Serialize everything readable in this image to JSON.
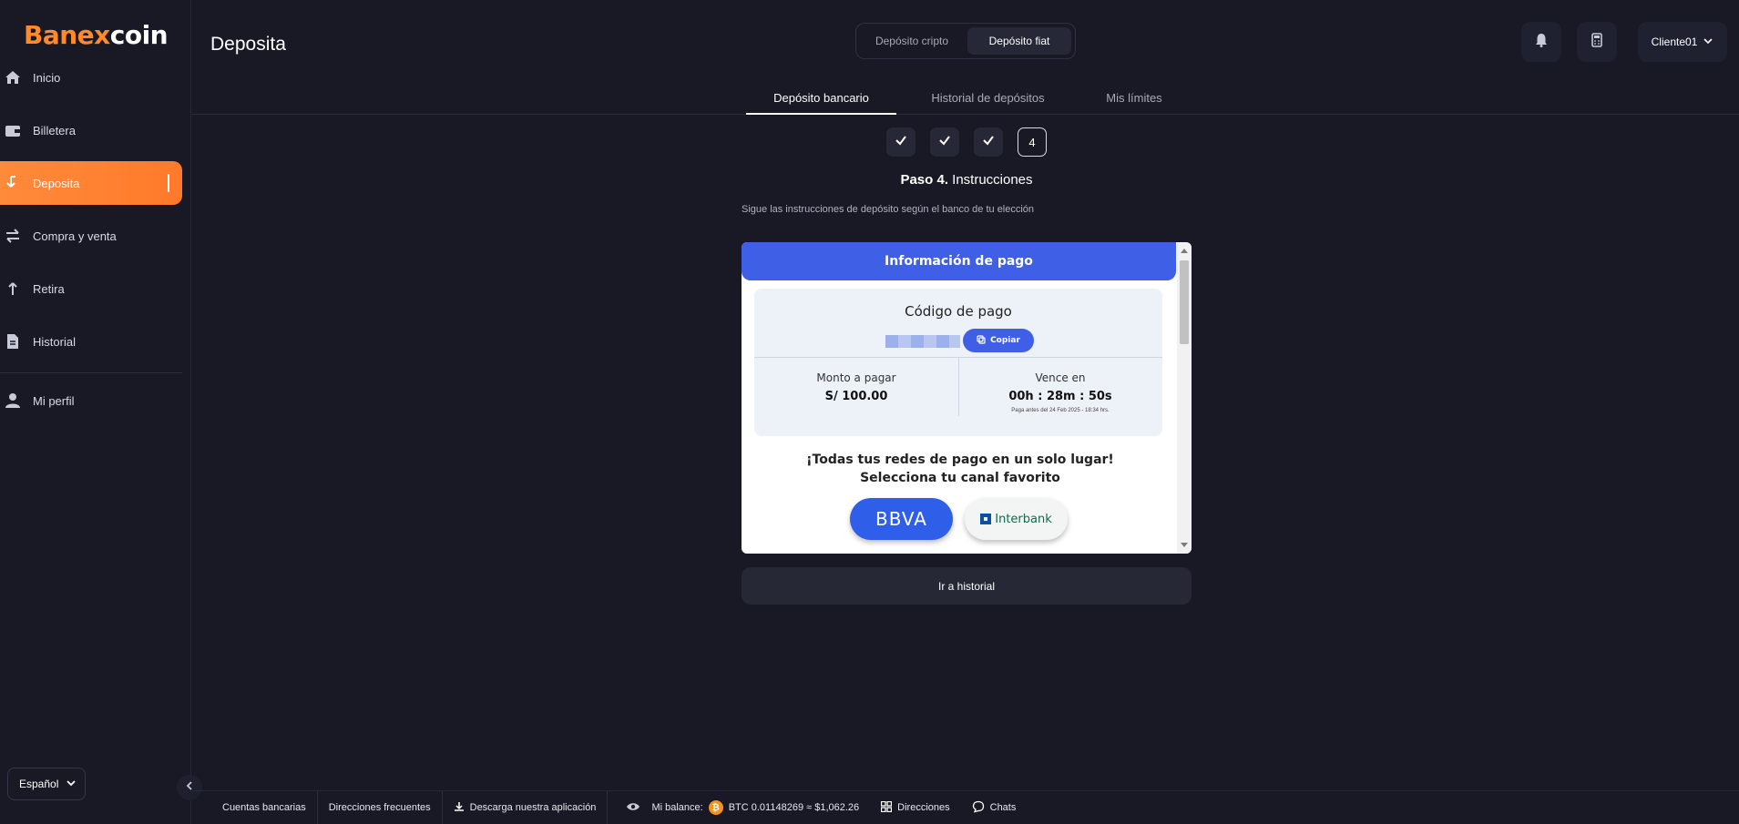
{
  "brand": {
    "logo_prefix": "B",
    "logo_rest": "anex",
    "logo_suffix": "coin"
  },
  "sidebar": {
    "items": [
      {
        "label": "Inicio",
        "icon": "home-icon"
      },
      {
        "label": "Billetera",
        "icon": "wallet-icon"
      },
      {
        "label": "Deposita",
        "icon": "arrow-down-icon",
        "active": true
      },
      {
        "label": "Compra y venta",
        "icon": "swap-icon"
      },
      {
        "label": "Retira",
        "icon": "arrow-up-icon"
      },
      {
        "label": "Historial",
        "icon": "document-icon"
      },
      {
        "label": "Mi perfil",
        "icon": "user-icon"
      }
    ],
    "language": "Español"
  },
  "header": {
    "title": "Deposita",
    "segments": [
      "Depósito cripto",
      "Depósito fiat"
    ],
    "active_segment": "Depósito fiat",
    "user": "Cliente01"
  },
  "tabs": [
    "Depósito bancario",
    "Historial de depósitos",
    "Mis límites"
  ],
  "steps": {
    "current": "4",
    "completed": 3
  },
  "step_title": {
    "bold": "Paso 4.",
    "rest": " Instrucciones"
  },
  "instructions": "Sigue las instrucciones de depósito según el banco de tu elección",
  "payment": {
    "header": "Información de pago",
    "code_title": "Código de pago",
    "copy_label": "Copiar",
    "amount_label": "Monto a pagar",
    "amount_value": "S/ 100.00",
    "expires_label": "Vence en",
    "expires_value": "00h : 28m : 50s",
    "expires_note": "Paga antes del 24 Feb 2025 - 18:34 hrs.",
    "promo": "¡Todas tus redes de pago en un solo lugar! Selecciona tu canal favorito",
    "banks": [
      "BBVA",
      "Interbank"
    ]
  },
  "history_button": "Ir a historial",
  "footer": {
    "bank_accounts": "Cuentas bancarias",
    "frequent_addresses": "Direcciones frecuentes",
    "download_app": "Descarga nuestra aplicación",
    "balance_label": "Mi balance:",
    "balance_value": "BTC 0.01148269 ≈ $1,062.26",
    "addresses": "Direcciones",
    "chats": "Chats"
  },
  "colors": {
    "accent": "#ff8a2b",
    "primary_blue": "#3e5fe6",
    "background": "#181925"
  }
}
